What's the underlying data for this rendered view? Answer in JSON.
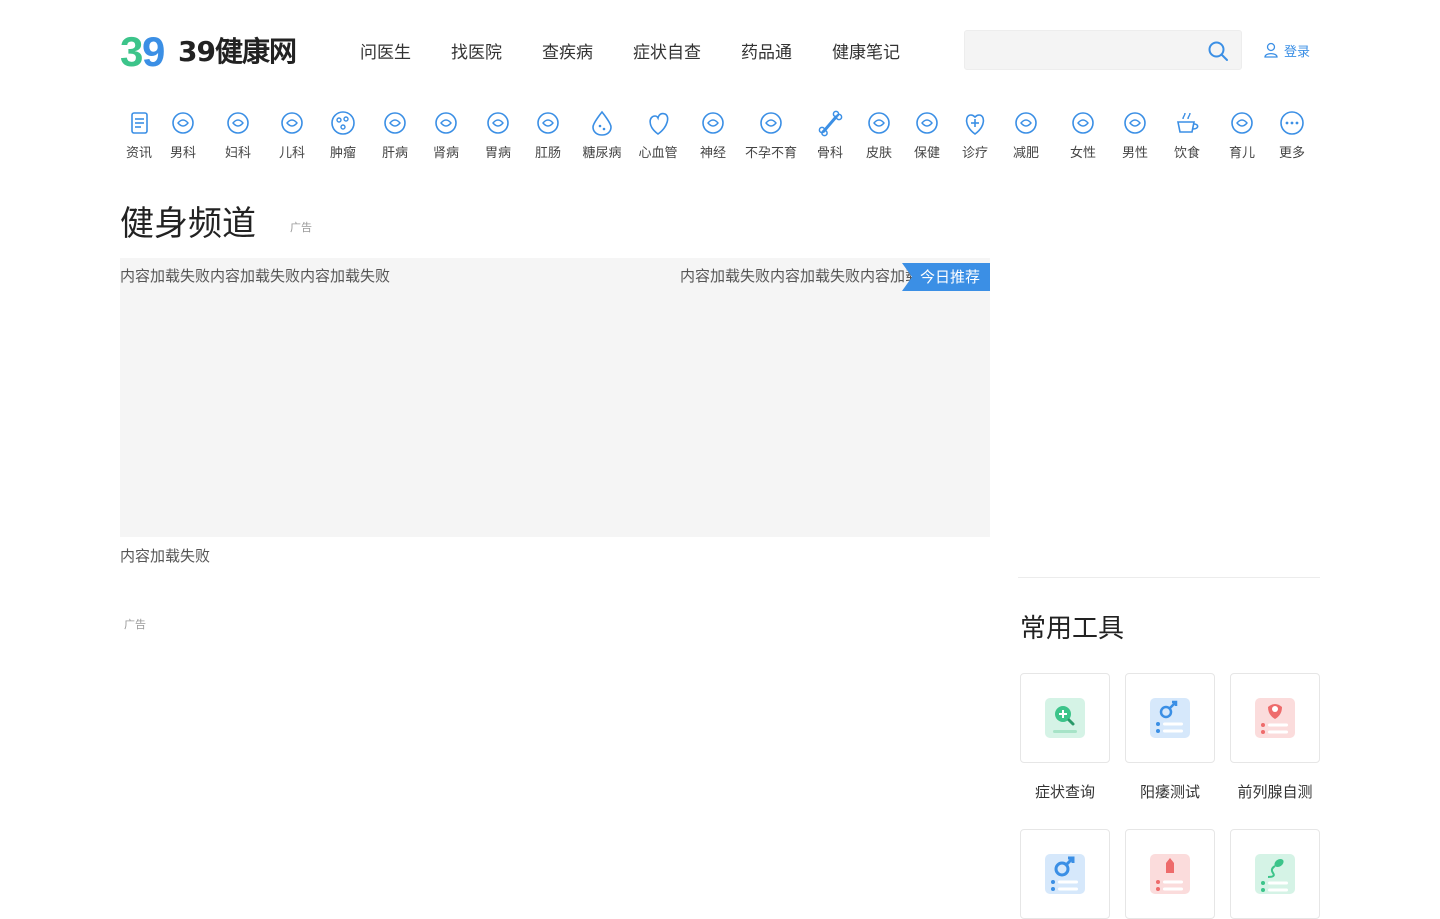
{
  "header": {
    "logo_text": "39健康网",
    "logo_mark": "39",
    "nav": [
      "问医生",
      "找医院",
      "查疾病",
      "症状自查",
      "药品通",
      "健康笔记"
    ],
    "search_placeholder": "",
    "login_label": "登录"
  },
  "categories": [
    {
      "label": "资讯",
      "icon": "news-icon"
    },
    {
      "label": "男科",
      "icon": "male-icon"
    },
    {
      "label": "妇科",
      "icon": "uterus-icon"
    },
    {
      "label": "儿科",
      "icon": "baby-icon"
    },
    {
      "label": "肿瘤",
      "icon": "tumor-icon"
    },
    {
      "label": "肝病",
      "icon": "liver-icon"
    },
    {
      "label": "肾病",
      "icon": "kidney-icon"
    },
    {
      "label": "胃病",
      "icon": "stomach-icon"
    },
    {
      "label": "肛肠",
      "icon": "intestine-icon"
    },
    {
      "label": "糖尿病",
      "icon": "drop-icon"
    },
    {
      "label": "心血管",
      "icon": "heart-icon"
    },
    {
      "label": "神经",
      "icon": "brain-icon"
    },
    {
      "label": "不孕不育",
      "icon": "egg-icon"
    },
    {
      "label": "骨科",
      "icon": "bone-icon"
    },
    {
      "label": "皮肤",
      "icon": "skin-icon"
    },
    {
      "label": "保健",
      "icon": "care-icon"
    },
    {
      "label": "诊疗",
      "icon": "plus-heart-icon"
    },
    {
      "label": "减肥",
      "icon": "waist-icon"
    },
    {
      "label": "女性",
      "icon": "female-icon"
    },
    {
      "label": "男性",
      "icon": "man-icon"
    },
    {
      "label": "饮食",
      "icon": "cup-icon"
    },
    {
      "label": "育儿",
      "icon": "infant-icon"
    },
    {
      "label": "更多",
      "icon": "more-icon"
    }
  ],
  "channel": {
    "title": "健身频道",
    "ad_label": "广告",
    "error_left": "内容加载失败内容加载失败内容加载失败",
    "error_right": "内容加载失败内容加载失败内容加载失败",
    "recommend_tag": "今日推荐",
    "error_bottom": "内容加载失败",
    "ad_label_2": "广告"
  },
  "tools": {
    "title": "常用工具",
    "items": [
      {
        "label": "症状查询",
        "icon": "symptom-search-icon",
        "color": "#3cc48a"
      },
      {
        "label": "阳痿测试",
        "icon": "male-test-icon",
        "color": "#3b8fe5"
      },
      {
        "label": "前列腺自测",
        "icon": "prostate-test-icon",
        "color": "#ee6b6b"
      },
      {
        "label": "",
        "icon": "male-symbol-icon",
        "color": "#3b8fe5"
      },
      {
        "label": "",
        "icon": "bottle-test-icon",
        "color": "#ee6b6b"
      },
      {
        "label": "",
        "icon": "sperm-icon",
        "color": "#3cc48a"
      }
    ]
  },
  "colors": {
    "brand_blue": "#3b8fe5",
    "brand_green": "#3cc48a"
  }
}
